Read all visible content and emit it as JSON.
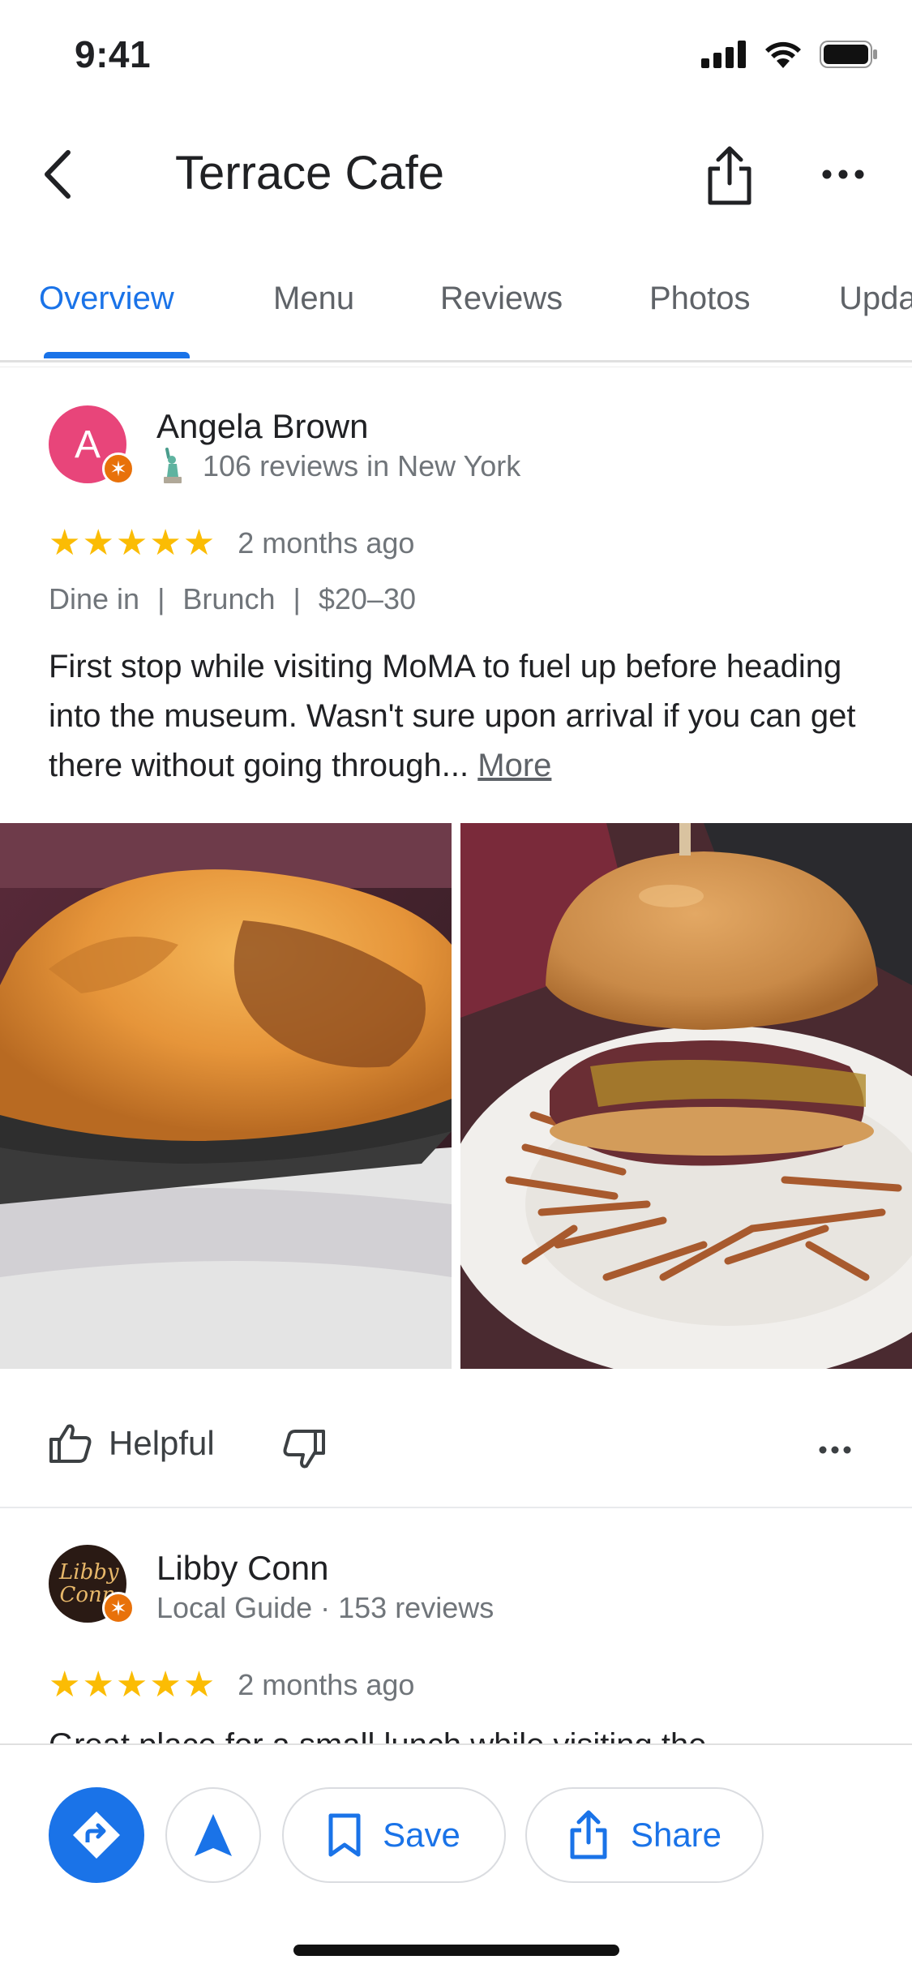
{
  "status_bar": {
    "time": "9:41"
  },
  "header": {
    "title": "Terrace Cafe"
  },
  "tabs": [
    {
      "label": "Overview"
    },
    {
      "label": "Menu"
    },
    {
      "label": "Reviews"
    },
    {
      "label": "Photos"
    },
    {
      "label": "Upda"
    }
  ],
  "reviews": [
    {
      "avatar_letter": "A",
      "name": "Angela Brown",
      "meta": "106 reviews in New York",
      "meta_icon": "statue-of-liberty-icon",
      "stars": "★★★★★",
      "time": "2 months ago",
      "tags": [
        "Dine in",
        "Brunch",
        "$20–30"
      ],
      "text": "First stop while visiting MoMA to fuel up before heading into the museum.  Wasn't sure upon arrival if you can get there without going through...",
      "more_label": "More",
      "helpful_label": "Helpful"
    },
    {
      "avatar_text": "Libby Conn",
      "name": "Libby Conn",
      "meta": "Local Guide · 153 reviews",
      "stars": "★★★★★",
      "time": "2 months ago",
      "text_partial": "Great place for a small lunch while visiting the"
    }
  ],
  "bottom_bar": {
    "save_label": "Save",
    "share_label": "Share"
  },
  "colors": {
    "accent": "#1a73e8",
    "star": "#fbbc04",
    "avatar_pink": "#e8457a",
    "badge_orange": "#e8710a"
  }
}
